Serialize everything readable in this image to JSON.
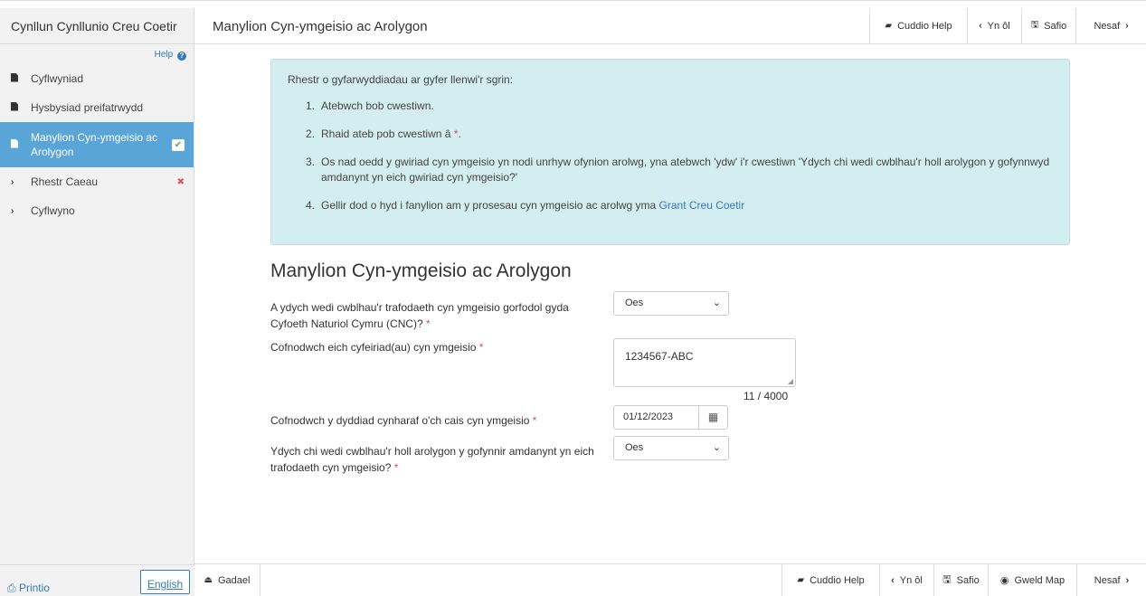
{
  "sidebar": {
    "title": "Cynllun Cynllunio Creu Coetir",
    "help_label": "Help",
    "items": [
      {
        "label": "Cyflwyniad"
      },
      {
        "label": "Hysbysiad preifatrwydd"
      },
      {
        "label": "Manylion Cyn-ymgeisio ac Arolygon"
      },
      {
        "label": "Rhestr Caeau"
      },
      {
        "label": "Cyflwyno"
      }
    ],
    "print_label": "Printio",
    "language_label": "English"
  },
  "topbar": {
    "title": "Manylion Cyn-ymgeisio ac Arolygon",
    "hide_help": "Cuddio Help",
    "back": "Yn ôl",
    "save": "Safio",
    "next": "Nesaf"
  },
  "help": {
    "intro": "Rhestr o gyfarwyddiadau ar gyfer llenwi'r sgrin:",
    "items": [
      {
        "num": "1.",
        "text": "Atebwch bob cwestiwn."
      },
      {
        "num": "2.",
        "text": "Rhaid ateb pob cwestiwn â",
        "req": "*",
        "tail": "."
      },
      {
        "num": "3.",
        "text": "Os nad oedd y gwiriad cyn ymgeisio yn nodi unrhyw ofynion arolwg, yna atebwch 'ydw' i'r cwestiwn 'Ydych chi wedi cwblhau'r holl arolygon y gofynnwyd amdanynt yn eich gwiriad cyn ymgeisio?'"
      },
      {
        "num": "4.",
        "text": "Gellir dod o hyd i fanylion am y prosesau cyn ymgeisio ac arolwg yma",
        "link": "Grant Creu Coetir"
      }
    ]
  },
  "form": {
    "title": "Manylion Cyn-ymgeisio ac Arolygon",
    "required_mark": "*",
    "q1": {
      "label": "A ydych wedi cwblhau'r trafodaeth cyn ymgeisio gorfodol gyda Cyfoeth Naturiol Cymru (CNC)?",
      "value": "Oes"
    },
    "q2": {
      "label": "Cofnodwch eich cyfeiriad(au) cyn ymgeisio",
      "value": "1234567-ABC",
      "counter": "11 / 4000"
    },
    "q3": {
      "label": "Cofnodwch y dyddiad cynharaf o'ch cais cyn ymgeisio",
      "value": "01/12/2023"
    },
    "q4": {
      "label": "Ydych chi wedi cwblhau'r holl arolygon y gofynnir amdanynt yn eich trafodaeth cyn ymgeisio?",
      "value": "Oes"
    }
  },
  "bottombar": {
    "leave": "Gadael",
    "hide_help": "Cuddio Help",
    "back": "Yn ôl",
    "save": "Safio",
    "view_map": "Gweld Map",
    "next": "Nesaf"
  },
  "colors": {
    "accent": "#337ab7",
    "active_nav": "#5aa5d8",
    "help_bg": "#d4edf1",
    "required": "#d9534f"
  }
}
